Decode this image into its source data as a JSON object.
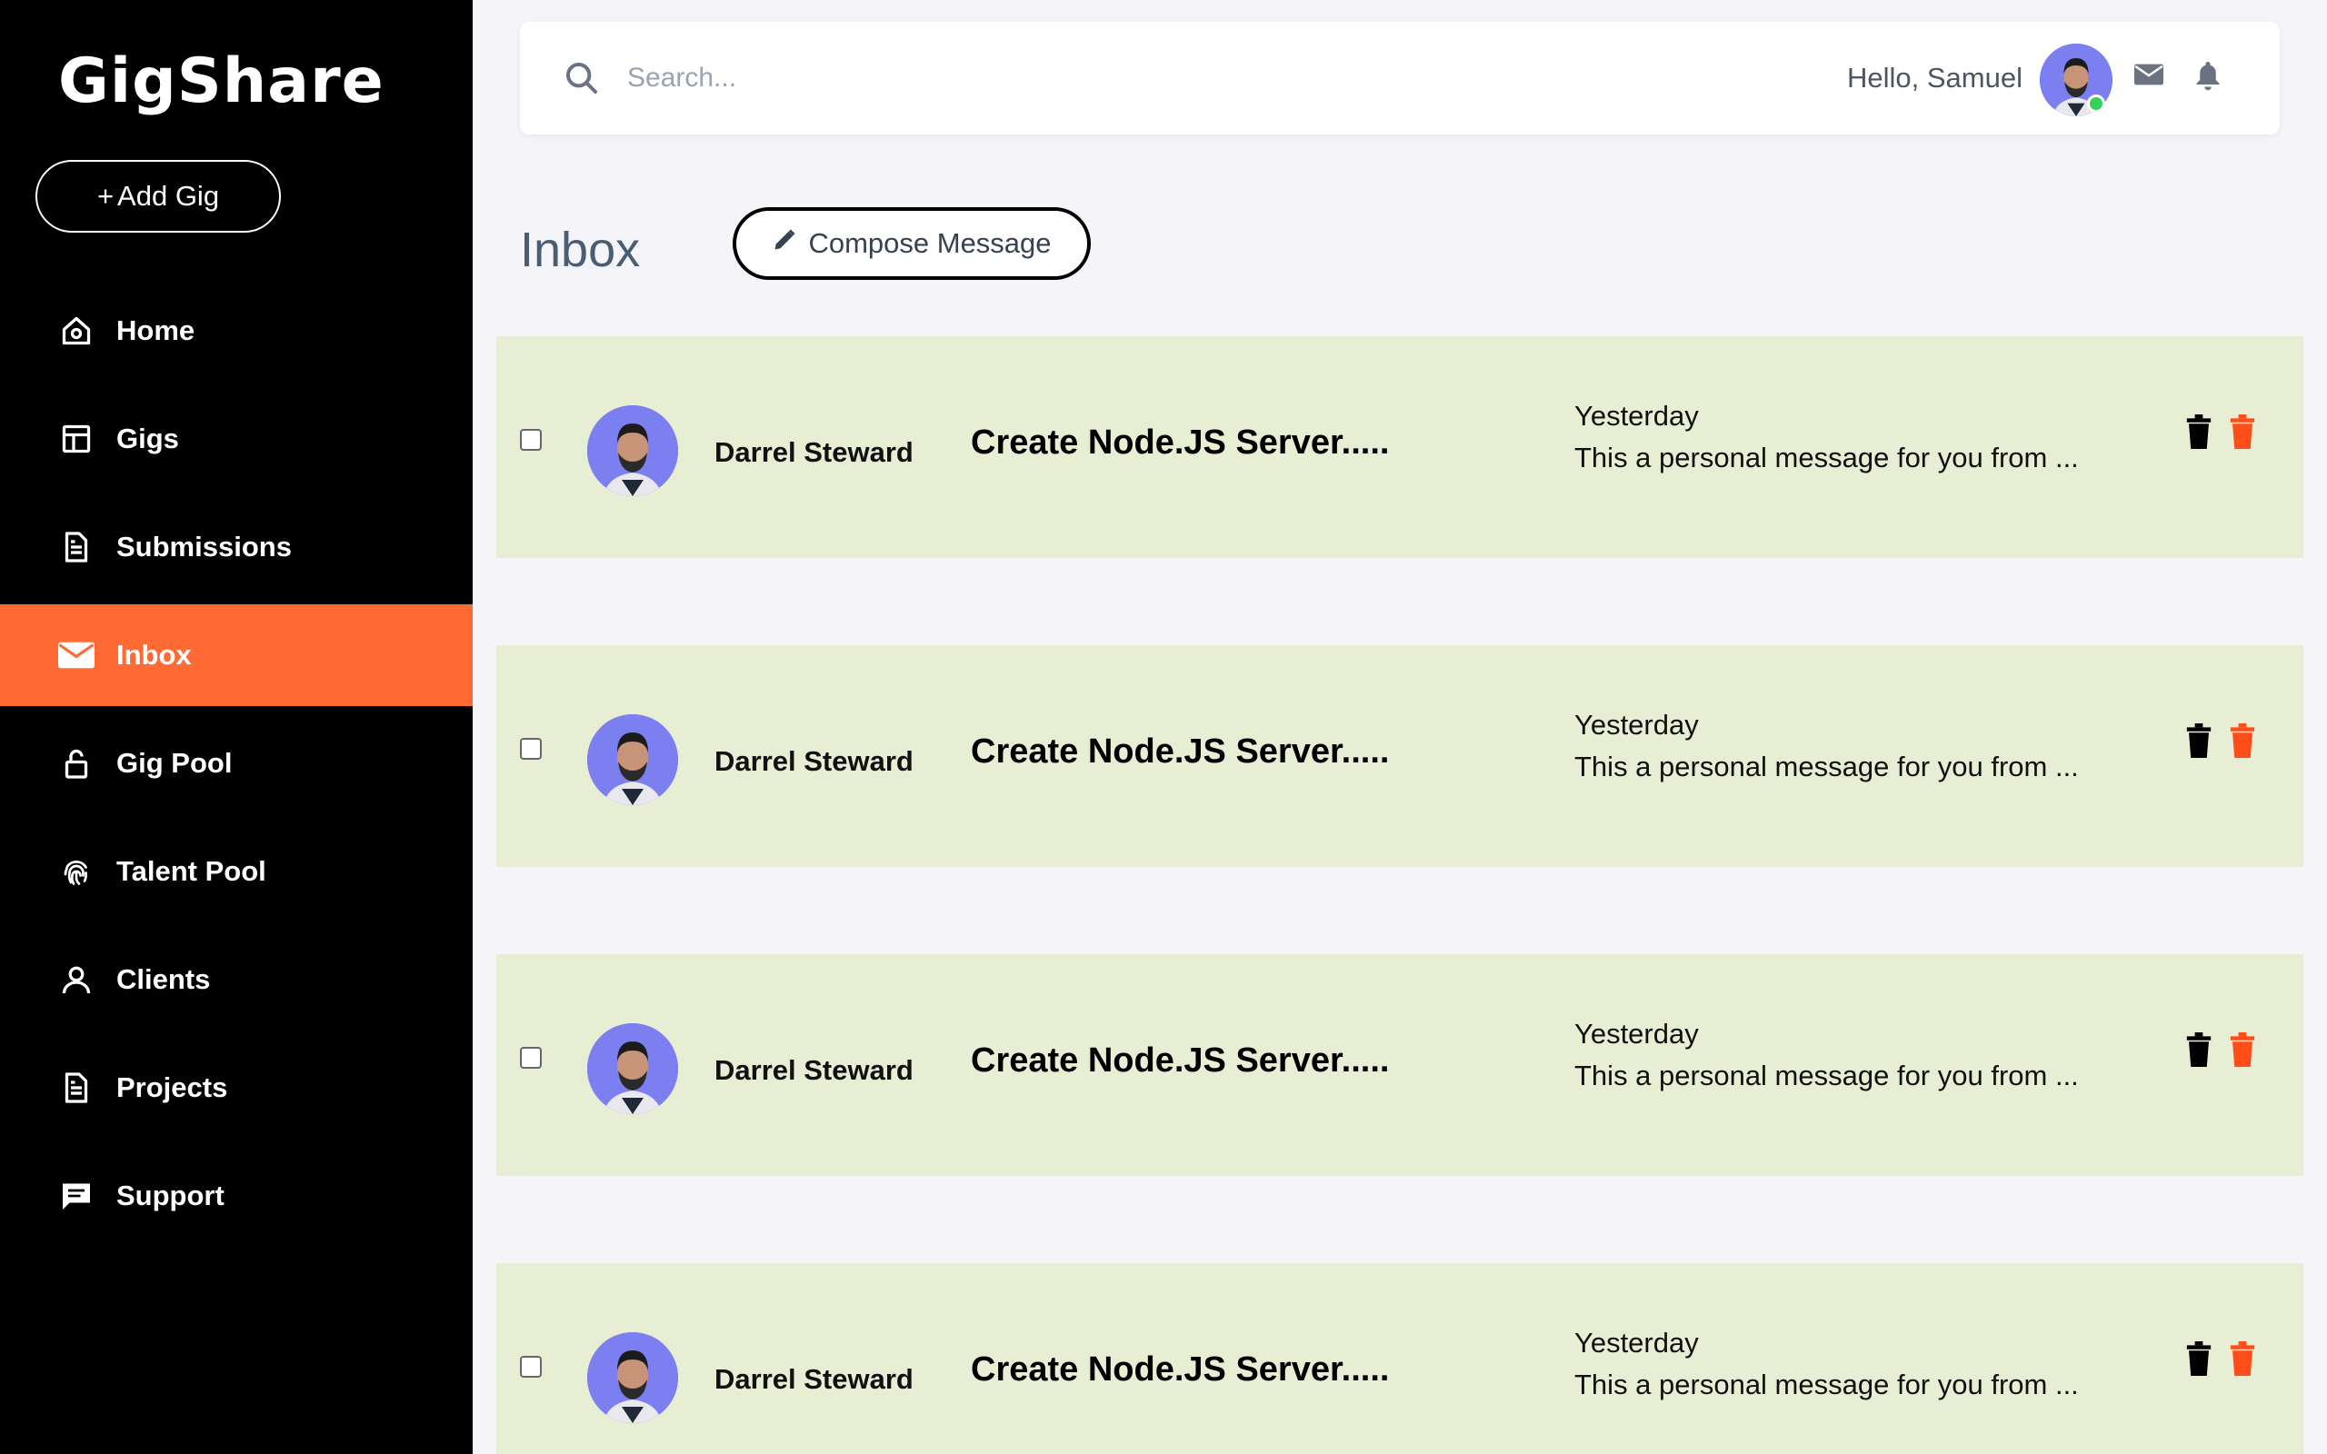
{
  "app": {
    "logo": "GigShare",
    "add_gig_label": "Add Gig"
  },
  "sidebar": {
    "items": [
      {
        "label": "Home",
        "icon": "home-icon",
        "active": false
      },
      {
        "label": "Gigs",
        "icon": "layout-icon",
        "active": false
      },
      {
        "label": "Submissions",
        "icon": "document-icon",
        "active": false
      },
      {
        "label": "Inbox",
        "icon": "envelope-icon",
        "active": true
      },
      {
        "label": "Gig Pool",
        "icon": "lock-icon",
        "active": false
      },
      {
        "label": "Talent Pool",
        "icon": "fingerprint-icon",
        "active": false
      },
      {
        "label": "Clients",
        "icon": "user-icon",
        "active": false
      },
      {
        "label": "Projects",
        "icon": "document-icon",
        "active": false
      },
      {
        "label": "Support",
        "icon": "chat-icon",
        "active": false
      }
    ]
  },
  "topbar": {
    "search_placeholder": "Search...",
    "greeting": "Hello, Samuel",
    "user_status": "online"
  },
  "inbox": {
    "title": "Inbox",
    "compose_label": "Compose Message",
    "messages": [
      {
        "sender": "Darrel Steward",
        "subject": "Create Node.JS Server.....",
        "date": "Yesterday",
        "preview": "This a personal message for you from ..."
      },
      {
        "sender": "Darrel Steward",
        "subject": "Create Node.JS Server.....",
        "date": "Yesterday",
        "preview": "This a personal message for you from ..."
      },
      {
        "sender": "Darrel Steward",
        "subject": "Create Node.JS Server.....",
        "date": "Yesterday",
        "preview": "This a personal message for you from ..."
      },
      {
        "sender": "Darrel Steward",
        "subject": "Create Node.JS Server.....",
        "date": "Yesterday",
        "preview": "This a personal message for you from ..."
      }
    ]
  },
  "colors": {
    "sidebar_bg": "#000000",
    "active_nav": "#ff6a35",
    "row_bg": "#e7eed4",
    "page_bg": "#f4f4f9",
    "delete_accent": "#ff4d1a"
  }
}
